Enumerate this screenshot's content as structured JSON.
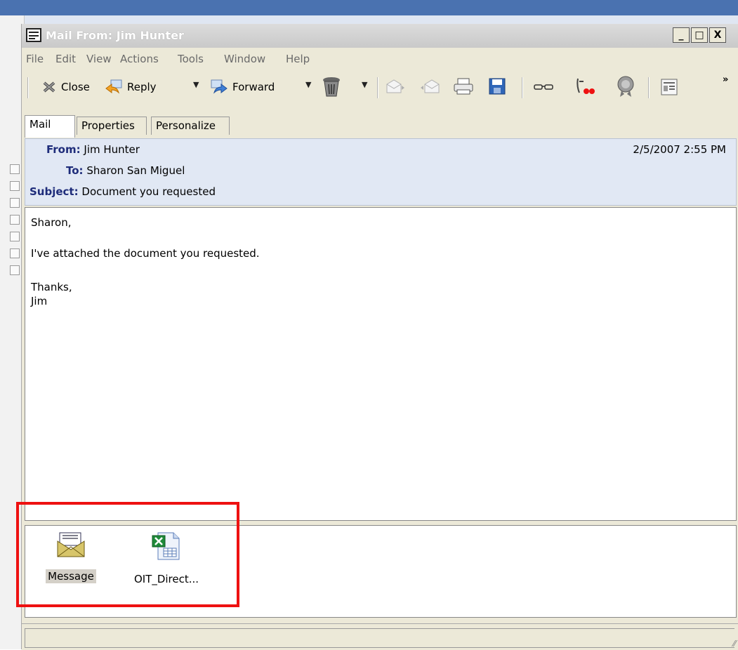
{
  "window": {
    "title": "Mail From: Jim Hunter",
    "controls": {
      "minimize": "_",
      "maximize": "□",
      "close": "X"
    }
  },
  "menu": [
    "File",
    "Edit",
    "View",
    "Actions",
    "Tools",
    "Window",
    "Help"
  ],
  "toolbar": {
    "close_label": "Close",
    "reply_label": "Reply",
    "forward_label": "Forward",
    "more": "»"
  },
  "tabs": [
    "Mail",
    "Properties",
    "Personalize"
  ],
  "header": {
    "from_label": "From:",
    "from": "Jim Hunter",
    "to_label": "To:",
    "to": "Sharon San Miguel",
    "subject_label": "Subject:",
    "subject": "Document you requested",
    "date": "2/5/2007 2:55 PM"
  },
  "body": {
    "greeting": "Sharon,",
    "line1": "I've attached the document you requested.",
    "closing": "Thanks,",
    "signature": "Jim"
  },
  "attachments": [
    {
      "label": "Message",
      "icon": "envelope-icon"
    },
    {
      "label": "OIT_Direct...",
      "icon": "excel-file-icon"
    }
  ],
  "colors": {
    "highlight_box": "#ee1111",
    "header_bg": "#e1e8f4"
  }
}
